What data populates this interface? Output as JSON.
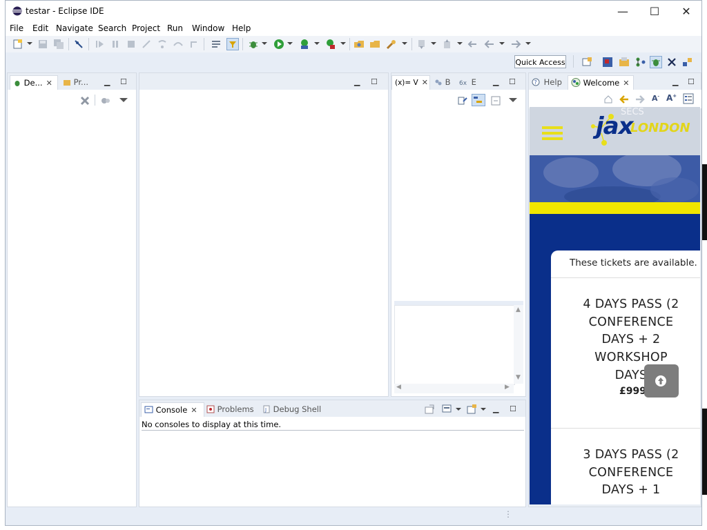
{
  "window": {
    "title": "testar - Eclipse IDE",
    "minimize_glyph": "—",
    "maximize_glyph": "☐",
    "close_glyph": "✕"
  },
  "menu": [
    "File",
    "Edit",
    "Navigate",
    "Search",
    "Project",
    "Run",
    "Window",
    "Help"
  ],
  "toolbar": {
    "quick_access": "Quick Access"
  },
  "debug_panel": {
    "tabs": [
      "De...",
      "Pr..."
    ]
  },
  "variables_panel": {
    "tabs": [
      "(x)= V",
      "B",
      "E"
    ]
  },
  "console_panel": {
    "tabs": [
      "Console",
      "Problems",
      "Debug Shell"
    ],
    "message": "No consoles to display at this time."
  },
  "browser_panel": {
    "tabs": [
      "Help",
      "Welcome"
    ]
  },
  "webpage": {
    "logo_jax": "jax",
    "logo_london": "LONDON",
    "secs_text": "SECS",
    "tickets_available": "These tickets are available.",
    "pass1_lines": [
      "4 DAYS PASS (2",
      "CONFERENCE",
      "DAYS + 2",
      "WORKSHOP",
      "DAYS"
    ],
    "pass1_price": "£999",
    "pass2_lines": [
      "3 DAYS PASS (2",
      "CONFERENCE",
      "DAYS + 1"
    ]
  },
  "colors": {
    "site_blue": "#0a2f8a",
    "site_yellow": "#f1e600",
    "eclipse_bg": "#e7edf6"
  }
}
